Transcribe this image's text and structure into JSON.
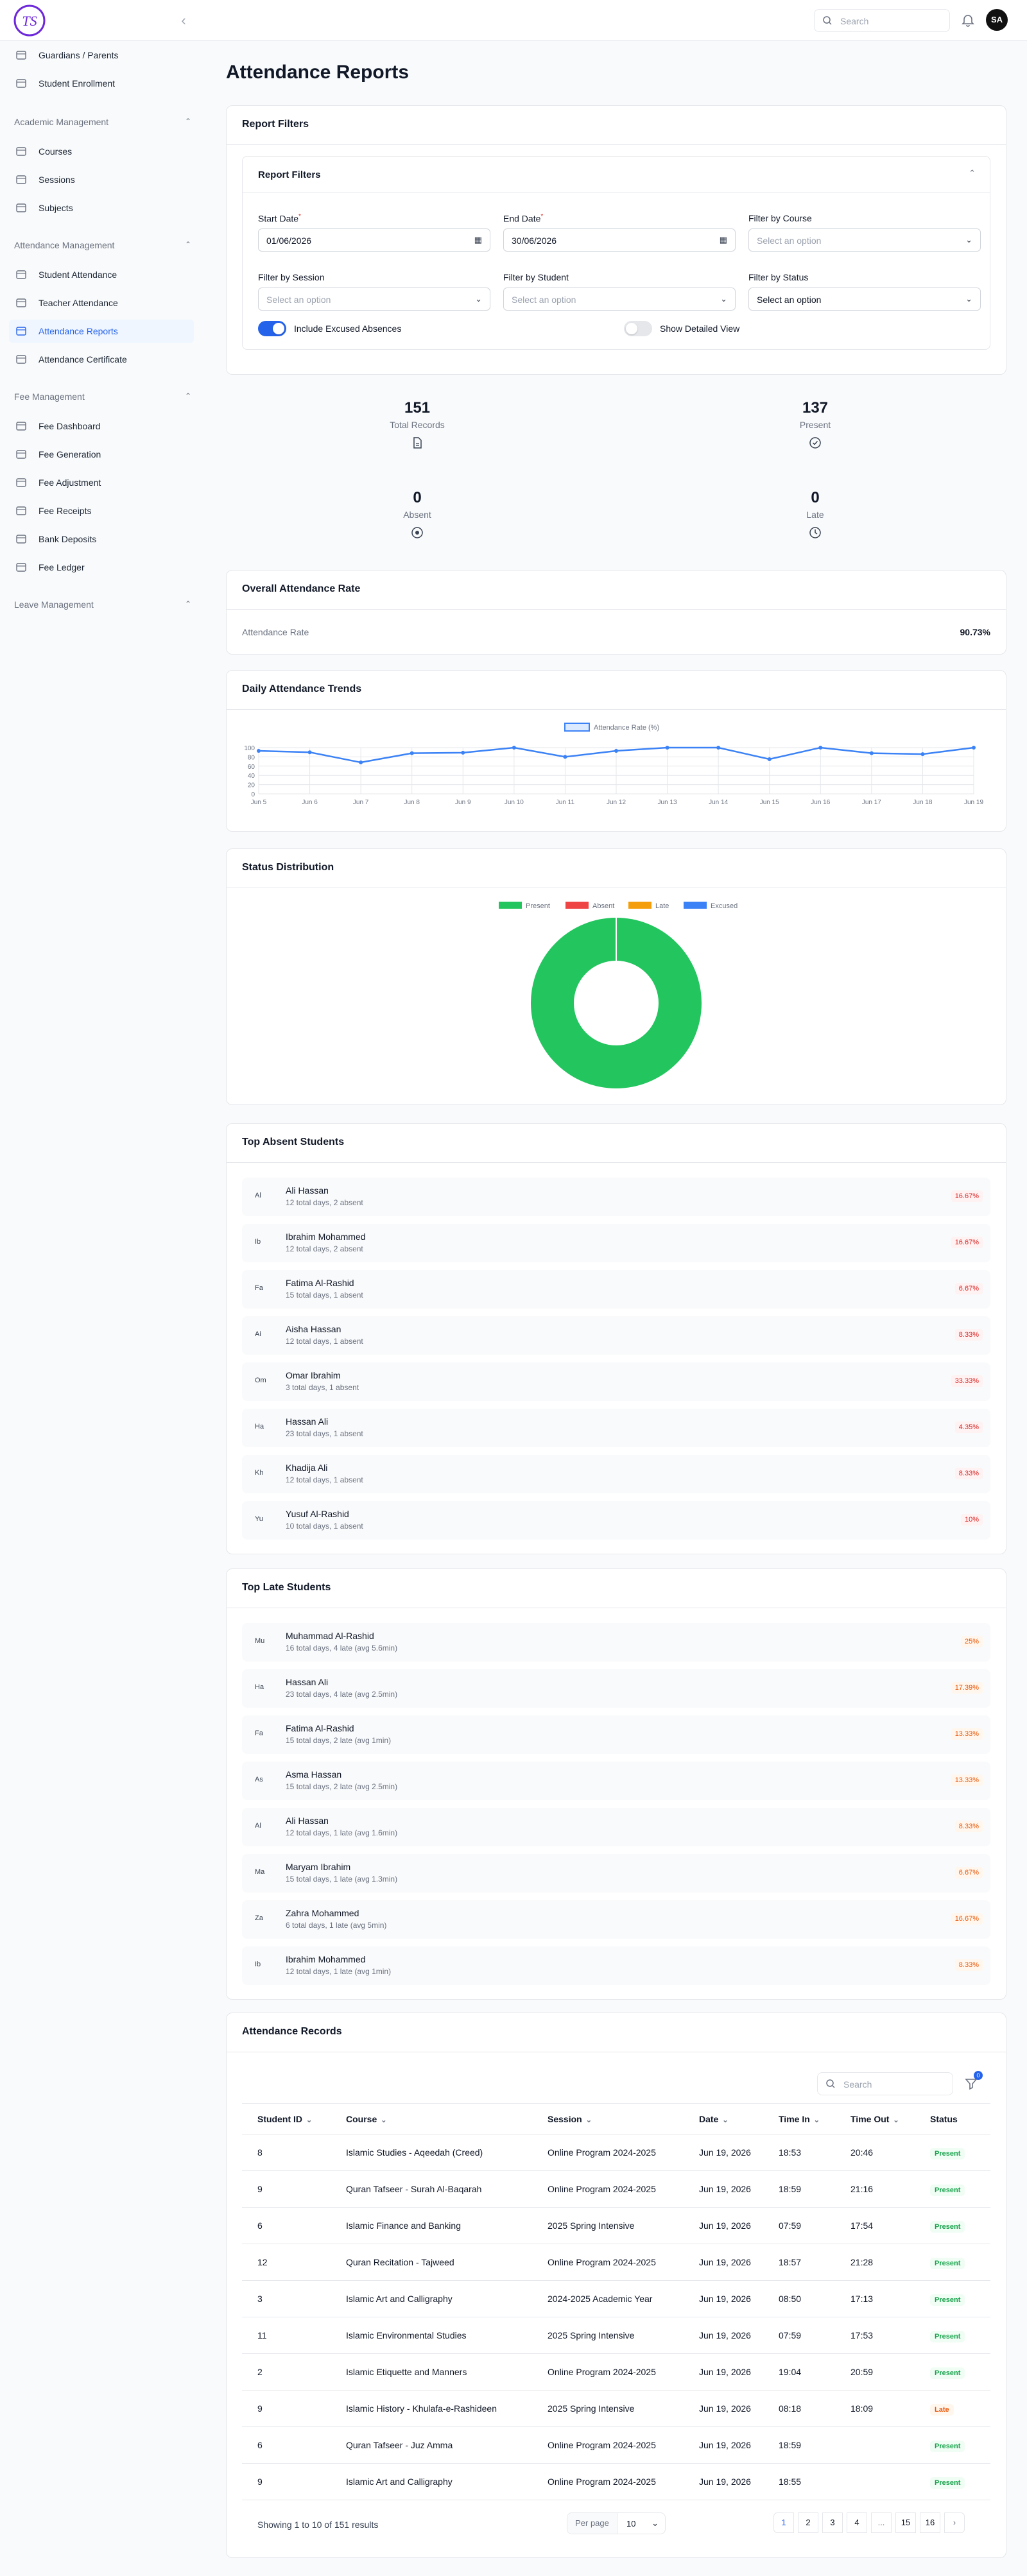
{
  "header": {
    "search_placeholder": "Search",
    "avatar_initials": "SA",
    "logo_text": "TS"
  },
  "sidebar": {
    "top_items": [
      {
        "label": "Guardians / Parents",
        "icon": "graduation-icon"
      },
      {
        "label": "Student Enrollment",
        "icon": "graduation-icon"
      }
    ],
    "sections": [
      {
        "title": "Academic Management",
        "items": [
          {
            "label": "Courses",
            "icon": "cap-icon"
          },
          {
            "label": "Sessions",
            "icon": "calendar-icon"
          },
          {
            "label": "Subjects",
            "icon": "book-icon"
          }
        ]
      },
      {
        "title": "Attendance Management",
        "items": [
          {
            "label": "Student Attendance",
            "icon": "calendar-icon"
          },
          {
            "label": "Teacher Attendance",
            "icon": "calendar-icon"
          },
          {
            "label": "Attendance Reports",
            "icon": "document-icon",
            "active": true
          },
          {
            "label": "Attendance Certificate",
            "icon": "document-icon"
          }
        ]
      },
      {
        "title": "Fee Management",
        "items": [
          {
            "label": "Fee Dashboard",
            "icon": "dollar-icon"
          },
          {
            "label": "Fee Generation",
            "icon": "dollar-icon"
          },
          {
            "label": "Fee Adjustment",
            "icon": "dollar-icon"
          },
          {
            "label": "Fee Receipts",
            "icon": "receipt-icon"
          },
          {
            "label": "Bank Deposits",
            "icon": "bank-icon"
          },
          {
            "label": "Fee Ledger",
            "icon": "book-icon"
          }
        ]
      },
      {
        "title": "Leave Management",
        "items": []
      }
    ]
  },
  "page": {
    "title": "Attendance Reports"
  },
  "filters": {
    "card_title": "Report Filters",
    "inner_title": "Report Filters",
    "start_label": "Start Date",
    "start_value": "01/06/2026",
    "end_label": "End Date",
    "end_value": "30/06/2026",
    "course_label": "Filter by Course",
    "course_placeholder": "Select an option",
    "session_label": "Filter by Session",
    "session_placeholder": "Select an option",
    "student_label": "Filter by Student",
    "student_placeholder": "Select an option",
    "status_label": "Filter by Status",
    "status_value": "Select an option",
    "excused_label": "Include Excused Absences",
    "excused_on": true,
    "detailed_label": "Show Detailed View",
    "detailed_on": false
  },
  "stats": [
    {
      "value": "151",
      "label": "Total Records",
      "icon": "document-icon"
    },
    {
      "value": "137",
      "label": "Present",
      "icon": "check-circle-icon"
    },
    {
      "value": "0",
      "label": "Absent",
      "icon": "x-circle-icon"
    },
    {
      "value": "0",
      "label": "Late",
      "icon": "clock-icon"
    }
  ],
  "overall": {
    "title": "Overall Attendance Rate",
    "label": "Attendance Rate",
    "value": "90.73%"
  },
  "trends": {
    "title": "Daily Attendance Trends"
  },
  "chart_data": [
    {
      "type": "line",
      "legend": "Attendance Rate (%)",
      "color": "#3b82f6",
      "x": [
        "Jun 5",
        "Jun 6",
        "Jun 7",
        "Jun 8",
        "Jun 9",
        "Jun 10",
        "Jun 11",
        "Jun 12",
        "Jun 13",
        "Jun 14",
        "Jun 15",
        "Jun 16",
        "Jun 17",
        "Jun 18",
        "Jun 19"
      ],
      "values": [
        93,
        90,
        68,
        88,
        89,
        100,
        80,
        93,
        100,
        100,
        75,
        100,
        88,
        86,
        100
      ],
      "yticks": [
        "100",
        "80",
        "60",
        "40",
        "20",
        "0"
      ],
      "ylim": [
        0,
        100
      ],
      "grid": true,
      "legend_position": "top"
    },
    {
      "type": "pie",
      "title": "Status Distribution",
      "labels": [
        "Present",
        "Absent",
        "Late",
        "Excused"
      ],
      "colors": [
        "#22c55e",
        "#ef4444",
        "#f59e0b",
        "#3b82f6"
      ],
      "values": [
        137,
        0,
        0,
        0
      ],
      "donut": true,
      "legend_position": "top"
    }
  ],
  "absent": {
    "title": "Top Absent Students",
    "items": [
      {
        "ini": "Al",
        "name": "Ali Hassan",
        "sub": "12 total days, 2 absent",
        "pct": "16.67%"
      },
      {
        "ini": "Ib",
        "name": "Ibrahim Mohammed",
        "sub": "12 total days, 2 absent",
        "pct": "16.67%"
      },
      {
        "ini": "Fa",
        "name": "Fatima Al-Rashid",
        "sub": "15 total days, 1 absent",
        "pct": "6.67%"
      },
      {
        "ini": "Ai",
        "name": "Aisha Hassan",
        "sub": "12 total days, 1 absent",
        "pct": "8.33%"
      },
      {
        "ini": "Om",
        "name": "Omar Ibrahim",
        "sub": "3 total days, 1 absent",
        "pct": "33.33%"
      },
      {
        "ini": "Ha",
        "name": "Hassan Ali",
        "sub": "23 total days, 1 absent",
        "pct": "4.35%"
      },
      {
        "ini": "Kh",
        "name": "Khadija Ali",
        "sub": "12 total days, 1 absent",
        "pct": "8.33%"
      },
      {
        "ini": "Yu",
        "name": "Yusuf Al-Rashid",
        "sub": "10 total days, 1 absent",
        "pct": "10%"
      }
    ]
  },
  "late": {
    "title": "Top Late Students",
    "items": [
      {
        "ini": "Mu",
        "name": "Muhammad Al-Rashid",
        "sub": "16 total days, 4 late (avg 5.6min)",
        "pct": "25%"
      },
      {
        "ini": "Ha",
        "name": "Hassan Ali",
        "sub": "23 total days, 4 late (avg 2.5min)",
        "pct": "17.39%"
      },
      {
        "ini": "Fa",
        "name": "Fatima Al-Rashid",
        "sub": "15 total days, 2 late (avg 1min)",
        "pct": "13.33%"
      },
      {
        "ini": "As",
        "name": "Asma Hassan",
        "sub": "15 total days, 2 late (avg 2.5min)",
        "pct": "13.33%"
      },
      {
        "ini": "Al",
        "name": "Ali Hassan",
        "sub": "12 total days, 1 late (avg 1.6min)",
        "pct": "8.33%"
      },
      {
        "ini": "Ma",
        "name": "Maryam Ibrahim",
        "sub": "15 total days, 1 late (avg 1.3min)",
        "pct": "6.67%"
      },
      {
        "ini": "Za",
        "name": "Zahra Mohammed",
        "sub": "6 total days, 1 late (avg 5min)",
        "pct": "16.67%"
      },
      {
        "ini": "Ib",
        "name": "Ibrahim Mohammed",
        "sub": "12 total days, 1 late (avg 1min)",
        "pct": "8.33%"
      }
    ]
  },
  "records": {
    "title": "Attendance Records",
    "search_placeholder": "Search",
    "filter_count": "0",
    "columns": [
      "Student ID",
      "Course",
      "Session",
      "Date",
      "Time In",
      "Time Out",
      "Status"
    ],
    "rows": [
      [
        "8",
        "Islamic Studies - Aqeedah (Creed)",
        "Online Program 2024-2025",
        "Jun 19, 2026",
        "18:53",
        "20:46",
        "Present"
      ],
      [
        "9",
        "Quran Tafseer - Surah Al-Baqarah",
        "Online Program 2024-2025",
        "Jun 19, 2026",
        "18:59",
        "21:16",
        "Present"
      ],
      [
        "6",
        "Islamic Finance and Banking",
        "2025 Spring Intensive",
        "Jun 19, 2026",
        "07:59",
        "17:54",
        "Present"
      ],
      [
        "12",
        "Quran Recitation - Tajweed",
        "Online Program 2024-2025",
        "Jun 19, 2026",
        "18:57",
        "21:28",
        "Present"
      ],
      [
        "3",
        "Islamic Art and Calligraphy",
        "2024-2025 Academic Year",
        "Jun 19, 2026",
        "08:50",
        "17:13",
        "Present"
      ],
      [
        "11",
        "Islamic Environmental Studies",
        "2025 Spring Intensive",
        "Jun 19, 2026",
        "07:59",
        "17:53",
        "Present"
      ],
      [
        "2",
        "Islamic Etiquette and Manners",
        "Online Program 2024-2025",
        "Jun 19, 2026",
        "19:04",
        "20:59",
        "Present"
      ],
      [
        "9",
        "Islamic History - Khulafa-e-Rashideen",
        "2025 Spring Intensive",
        "Jun 19, 2026",
        "08:18",
        "18:09",
        "Late"
      ],
      [
        "6",
        "Quran Tafseer - Juz Amma",
        "Online Program 2024-2025",
        "Jun 19, 2026",
        "18:59",
        "",
        "Present"
      ],
      [
        "9",
        "Islamic Art and Calligraphy",
        "Online Program 2024-2025",
        "Jun 19, 2026",
        "18:55",
        "",
        "Present"
      ]
    ],
    "summary": "Showing 1 to 10 of 151 results",
    "per_page_label": "Per page",
    "per_page_value": "10",
    "pages": [
      "1",
      "2",
      "3",
      "4",
      "...",
      "15",
      "16"
    ]
  }
}
